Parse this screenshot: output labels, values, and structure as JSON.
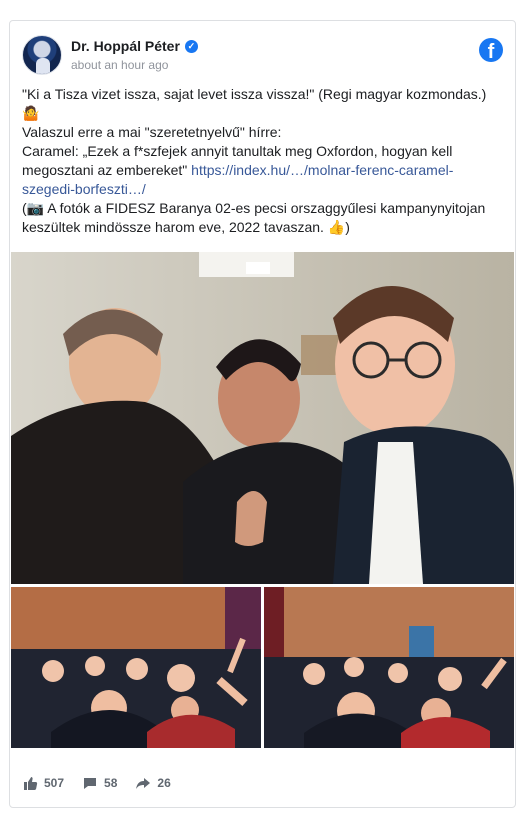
{
  "post": {
    "author": "Dr. Hoppál Péter",
    "time": "about an hour ago",
    "verified_icon": "verified-badge-icon",
    "platform_icon": "facebook-logo-icon",
    "lines": [
      "\"Ki a Tisza vizet issza, sajat levet issza vissza!\" (Regi magyar kozmondas.)",
      "🤷",
      "Valaszul erre a mai \"szeretetnyelvű\" hírre:",
      "Caramel: „Ezek a f*szfejek annyit tanultak meg Oxfordon, hogyan kell megosztani az embereket\"",
      "https://index.hu/…/molnar-ferenc-caramel-szegedi-borfeszti…/",
      "(📷 A fotók a FIDESZ Baranya 02-es pecsi orszaggyűlesi kampanynyitojan keszültek mindössze harom eve, 2022 tavaszan. 👍)"
    ],
    "images": [
      {
        "name": "selfie-photo",
        "description_icon": "photo-icon"
      },
      {
        "name": "crowd-photo-left",
        "description_icon": "photo-icon"
      },
      {
        "name": "crowd-photo-right",
        "description_icon": "photo-icon"
      }
    ]
  },
  "stats": {
    "likes": "507",
    "comments": "58",
    "shares": "26",
    "like_icon": "thumbs-up-icon",
    "comment_icon": "comment-icon",
    "share_icon": "share-icon"
  },
  "colors": {
    "link": "#385898",
    "facebook_blue": "#1877f2",
    "text": "#1c1e21",
    "muted": "#90949c"
  }
}
